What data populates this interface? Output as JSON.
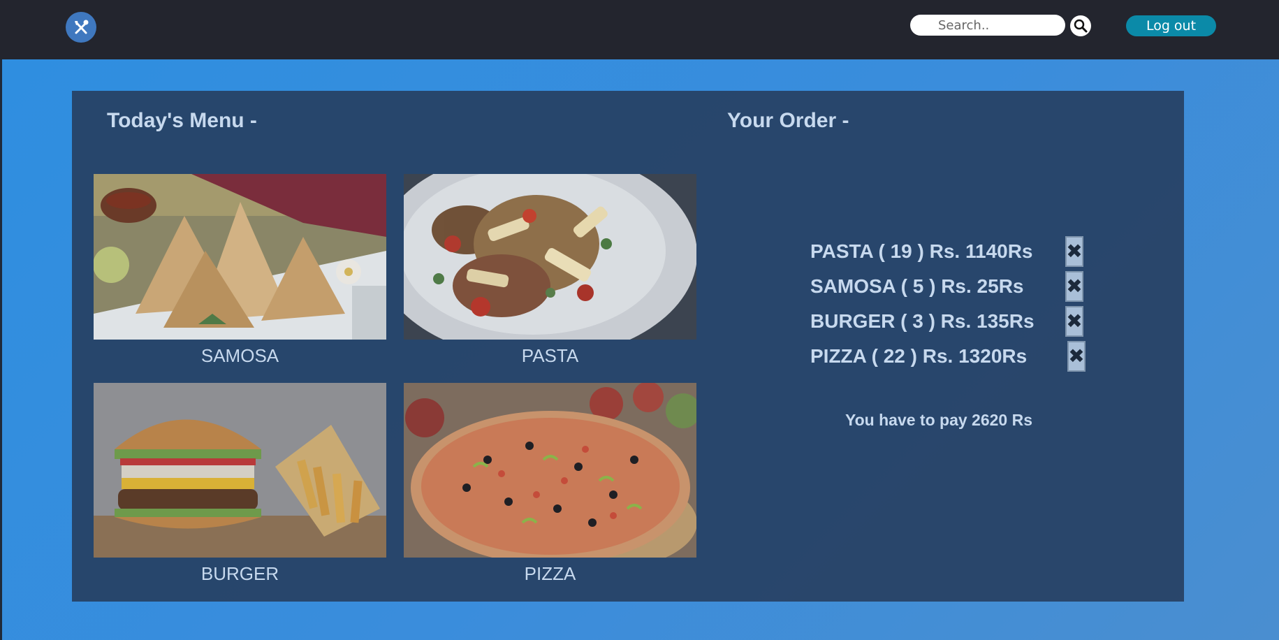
{
  "search": {
    "placeholder": "Search.."
  },
  "header": {
    "logout_label": "Log out"
  },
  "menu": {
    "title": "Today's Menu -",
    "items": [
      {
        "label": "SAMOSA",
        "icon": "samosa-image"
      },
      {
        "label": "PASTA",
        "icon": "pasta-image"
      },
      {
        "label": "BURGER",
        "icon": "burger-image"
      },
      {
        "label": "PIZZA",
        "icon": "pizza-image"
      }
    ]
  },
  "order": {
    "title": "Your Order -",
    "rows": [
      {
        "text": "PASTA ( 19 ) Rs. 1140Rs"
      },
      {
        "text": "SAMOSA ( 5 ) Rs. 25Rs"
      },
      {
        "text": "BURGER ( 3 ) Rs. 135Rs"
      },
      {
        "text": "PIZZA ( 22 ) Rs. 1320Rs"
      }
    ],
    "remove_glyph": "✖",
    "total": "You have to pay 2620 Rs"
  },
  "colors": {
    "topbar": "#23252e",
    "accent": "#0b8aa8",
    "panel": "#263c5c",
    "text": "#c7d9ee"
  }
}
